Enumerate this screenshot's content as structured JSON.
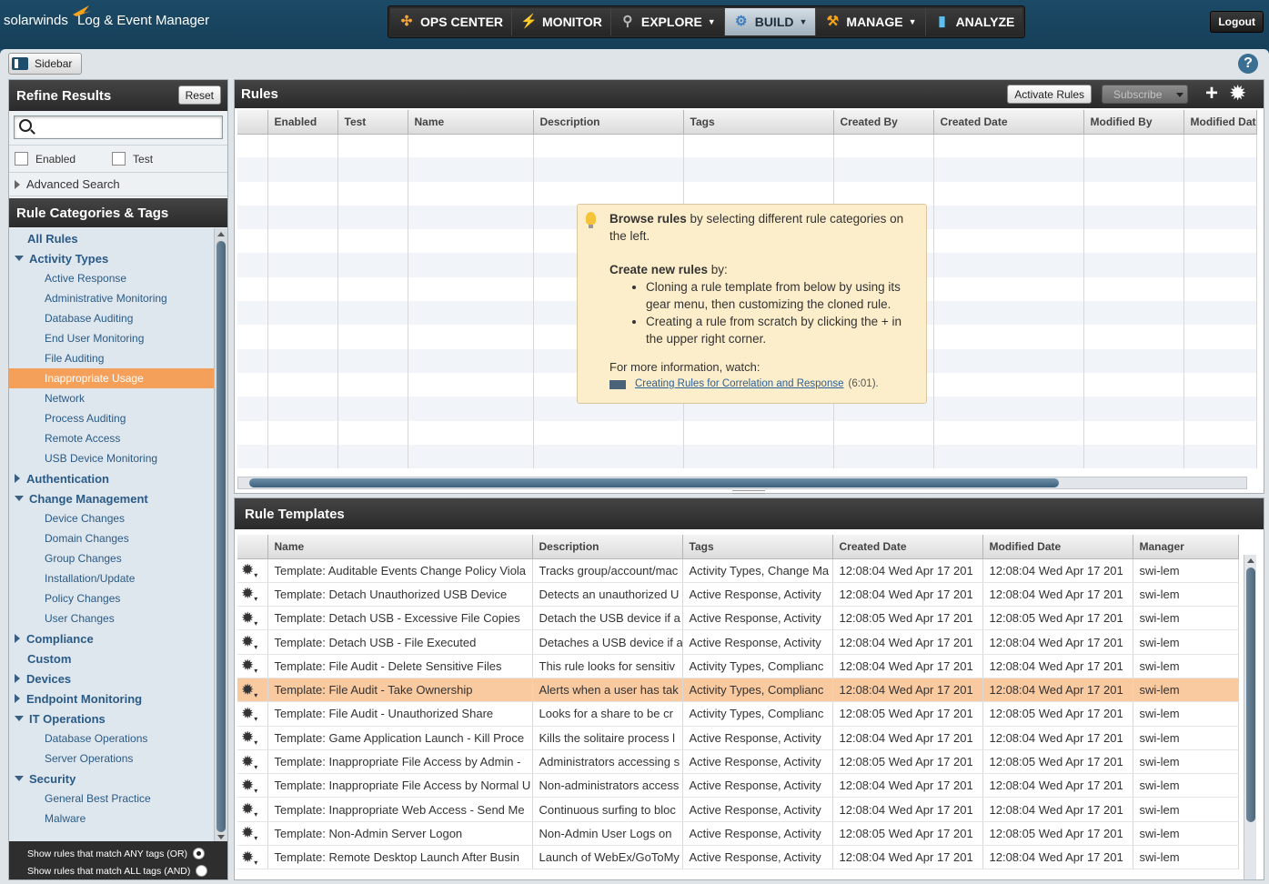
{
  "brand": {
    "company": "solarwinds",
    "product": "Log & Event Manager"
  },
  "nav": [
    {
      "label": "OPS CENTER",
      "icon": "ops-center-icon",
      "caret": false,
      "active": false
    },
    {
      "label": "MONITOR",
      "icon": "lightning-icon",
      "caret": false,
      "active": false
    },
    {
      "label": "EXPLORE",
      "icon": "explore-icon",
      "caret": true,
      "active": false
    },
    {
      "label": "BUILD",
      "icon": "gear-icon",
      "caret": true,
      "active": true
    },
    {
      "label": "MANAGE",
      "icon": "wrench-icon",
      "caret": true,
      "active": false
    },
    {
      "label": "ANALYZE",
      "icon": "bar-chart-icon",
      "caret": false,
      "active": false
    }
  ],
  "logout_label": "Logout",
  "sidebar_toggle_label": "Sidebar",
  "help_label": "?",
  "refine": {
    "title": "Refine Results",
    "reset_label": "Reset",
    "search_placeholder": "",
    "filter_enabled": "Enabled",
    "filter_test": "Test",
    "advanced_search": "Advanced Search"
  },
  "categories": {
    "title": "Rule Categories & Tags",
    "items": [
      {
        "label": "All Rules",
        "level": "top",
        "chevron": "none"
      },
      {
        "label": "Activity Types",
        "level": "top",
        "chevron": "down"
      },
      {
        "label": "Active Response",
        "level": "sub"
      },
      {
        "label": "Administrative Monitoring",
        "level": "sub"
      },
      {
        "label": "Database Auditing",
        "level": "sub"
      },
      {
        "label": "End User Monitoring",
        "level": "sub"
      },
      {
        "label": "File Auditing",
        "level": "sub"
      },
      {
        "label": "Inappropriate Usage",
        "level": "sub",
        "selected": true
      },
      {
        "label": "Network",
        "level": "sub"
      },
      {
        "label": "Process Auditing",
        "level": "sub"
      },
      {
        "label": "Remote Access",
        "level": "sub"
      },
      {
        "label": "USB Device Monitoring",
        "level": "sub"
      },
      {
        "label": "Authentication",
        "level": "top",
        "chevron": "right"
      },
      {
        "label": "Change Management",
        "level": "top",
        "chevron": "down"
      },
      {
        "label": "Device Changes",
        "level": "sub"
      },
      {
        "label": "Domain Changes",
        "level": "sub"
      },
      {
        "label": "Group Changes",
        "level": "sub"
      },
      {
        "label": "Installation/Update",
        "level": "sub"
      },
      {
        "label": "Policy Changes",
        "level": "sub"
      },
      {
        "label": "User Changes",
        "level": "sub"
      },
      {
        "label": "Compliance",
        "level": "top",
        "chevron": "right"
      },
      {
        "label": "Custom",
        "level": "top",
        "chevron": "none"
      },
      {
        "label": "Devices",
        "level": "top",
        "chevron": "right"
      },
      {
        "label": "Endpoint Monitoring",
        "level": "top",
        "chevron": "right"
      },
      {
        "label": "IT Operations",
        "level": "top",
        "chevron": "down"
      },
      {
        "label": "Database Operations",
        "level": "sub"
      },
      {
        "label": "Server Operations",
        "level": "sub"
      },
      {
        "label": "Security",
        "level": "top",
        "chevron": "down"
      },
      {
        "label": "General Best Practice",
        "level": "sub"
      },
      {
        "label": "Malware",
        "level": "sub"
      }
    ],
    "match_any": "Show rules that match ANY tags (OR)",
    "match_all": "Show rules that match ALL tags (AND)"
  },
  "rules": {
    "title": "Rules",
    "activate_label": "Activate Rules",
    "subscribe_label": "Subscribe",
    "add_label": "+",
    "columns": [
      "",
      "Enabled",
      "Test",
      "Name",
      "Description",
      "Tags",
      "Created By",
      "Created Date",
      "Modified By",
      "Modified Dat"
    ],
    "tip": {
      "line1_bold": "Browse rules",
      "line1_rest": " by selecting different rule categories on the left.",
      "line2_bold": "Create new rules",
      "line2_rest": " by:",
      "bullet1": "Cloning a rule template from below by using its gear menu, then customizing the cloned rule.",
      "bullet2": "Creating a rule from scratch by clicking the + in the upper right corner.",
      "more": "For more information, watch:",
      "link": "Creating Rules for Correlation and Response",
      "duration": "(6:01)."
    }
  },
  "templates": {
    "title": "Rule Templates",
    "columns": [
      "",
      "Name",
      "Description",
      "Tags",
      "Created Date",
      "Modified Date",
      "Manager"
    ],
    "rows": [
      {
        "name": "Template: Auditable Events Change Policy Viola",
        "desc": "Tracks group/account/mac",
        "tags": "Activity Types, Change Ma",
        "created": "12:08:04 Wed Apr 17 201",
        "modified": "12:08:04 Wed Apr 17 201",
        "manager": "swi-lem"
      },
      {
        "name": "Template: Detach Unauthorized USB Device",
        "desc": "Detects an unauthorized U",
        "tags": "Active Response, Activity",
        "created": "12:08:04 Wed Apr 17 201",
        "modified": "12:08:04 Wed Apr 17 201",
        "manager": "swi-lem"
      },
      {
        "name": "Template: Detach USB - Excessive File Copies",
        "desc": "Detach the USB device if a",
        "tags": "Active Response, Activity",
        "created": "12:08:05 Wed Apr 17 201",
        "modified": "12:08:05 Wed Apr 17 201",
        "manager": "swi-lem"
      },
      {
        "name": "Template: Detach USB - File Executed",
        "desc": "Detaches a USB device if a",
        "tags": "Active Response, Activity",
        "created": "12:08:04 Wed Apr 17 201",
        "modified": "12:08:04 Wed Apr 17 201",
        "manager": "swi-lem"
      },
      {
        "name": "Template: File Audit - Delete Sensitive Files",
        "desc": "This rule looks for sensitiv",
        "tags": "Activity Types, Complianc",
        "created": "12:08:04 Wed Apr 17 201",
        "modified": "12:08:04 Wed Apr 17 201",
        "manager": "swi-lem"
      },
      {
        "name": "Template: File Audit - Take Ownership",
        "desc": "Alerts when a user has tak",
        "tags": "Activity Types, Complianc",
        "created": "12:08:04 Wed Apr 17 201",
        "modified": "12:08:04 Wed Apr 17 201",
        "manager": "swi-lem",
        "selected": true
      },
      {
        "name": "Template: File Audit - Unauthorized Share",
        "desc": "Looks for a share to be cr",
        "tags": "Activity Types, Complianc",
        "created": "12:08:05 Wed Apr 17 201",
        "modified": "12:08:05 Wed Apr 17 201",
        "manager": "swi-lem"
      },
      {
        "name": "Template: Game Application Launch - Kill Proce",
        "desc": "Kills the solitaire process l",
        "tags": "Active Response, Activity",
        "created": "12:08:04 Wed Apr 17 201",
        "modified": "12:08:04 Wed Apr 17 201",
        "manager": "swi-lem"
      },
      {
        "name": "Template: Inappropriate File Access by Admin -",
        "desc": "Administrators accessing s",
        "tags": "Active Response, Activity",
        "created": "12:08:05 Wed Apr 17 201",
        "modified": "12:08:05 Wed Apr 17 201",
        "manager": "swi-lem"
      },
      {
        "name": "Template: Inappropriate File Access by Normal U",
        "desc": "Non-administrators access",
        "tags": "Active Response, Activity",
        "created": "12:08:04 Wed Apr 17 201",
        "modified": "12:08:04 Wed Apr 17 201",
        "manager": "swi-lem"
      },
      {
        "name": "Template: Inappropriate Web Access - Send Me",
        "desc": "Continuous surfing to bloc",
        "tags": "Active Response, Activity",
        "created": "12:08:04 Wed Apr 17 201",
        "modified": "12:08:04 Wed Apr 17 201",
        "manager": "swi-lem"
      },
      {
        "name": "Template: Non-Admin Server Logon",
        "desc": "Non-Admin User Logs on",
        "tags": "Active Response, Activity",
        "created": "12:08:05 Wed Apr 17 201",
        "modified": "12:08:05 Wed Apr 17 201",
        "manager": "swi-lem"
      },
      {
        "name": "Template: Remote Desktop Launch After Busin",
        "desc": "Launch of WebEx/GoToMy",
        "tags": "Active Response, Activity",
        "created": "12:08:04 Wed Apr 17 201",
        "modified": "12:08:04 Wed Apr 17 201",
        "manager": "swi-lem"
      }
    ]
  }
}
